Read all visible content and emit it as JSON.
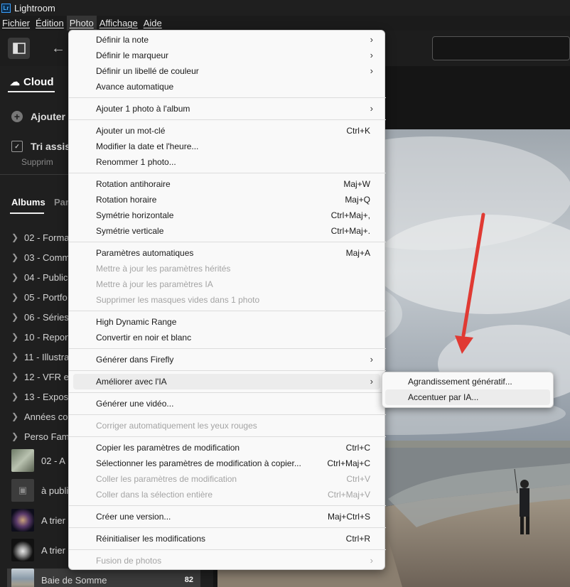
{
  "app": {
    "title": "Lightroom",
    "logo": "Lr"
  },
  "menubar": [
    "Fichier",
    "Édition",
    "Photo",
    "Affichage",
    "Aide"
  ],
  "sidebar": {
    "cloud_label": "Cloud",
    "add_label": "Ajouter",
    "sort_label": "Tri assist",
    "sub_label": "Supprim",
    "tabs": [
      "Albums",
      "Par"
    ],
    "albums": [
      "02 - Forma",
      "03 - Comm",
      "04 - Publica",
      "05 - Portfo",
      "06 - Séries",
      "10 - Report",
      "11 - Illustra",
      "12 - VFR et",
      "13 - Expos",
      "Années cor",
      "Perso Fami"
    ],
    "thumb_items": [
      "02 - A",
      "à publi",
      "A trier",
      "A trier"
    ],
    "selected_album": {
      "label": "Baie de Somme",
      "count": "82"
    }
  },
  "photo_menu": {
    "items": [
      {
        "label": "Définir la note",
        "shortcut": "",
        "submenu": true,
        "disabled": false
      },
      {
        "label": "Définir le marqueur",
        "shortcut": "",
        "submenu": true,
        "disabled": false
      },
      {
        "label": "Définir un libellé de couleur",
        "shortcut": "",
        "submenu": true,
        "disabled": false
      },
      {
        "label": "Avance automatique",
        "shortcut": "",
        "submenu": false,
        "disabled": false
      },
      {
        "label": "Ajouter 1 photo à l'album",
        "shortcut": "",
        "submenu": true,
        "disabled": false
      },
      {
        "label": "Ajouter un mot-clé",
        "shortcut": "Ctrl+K",
        "submenu": false,
        "disabled": false
      },
      {
        "label": "Modifier la date et l'heure...",
        "shortcut": "",
        "submenu": false,
        "disabled": false
      },
      {
        "label": "Renommer 1 photo...",
        "shortcut": "",
        "submenu": false,
        "disabled": false
      },
      {
        "label": "Rotation antihoraire",
        "shortcut": "Maj+W",
        "submenu": false,
        "disabled": false
      },
      {
        "label": "Rotation horaire",
        "shortcut": "Maj+Q",
        "submenu": false,
        "disabled": false
      },
      {
        "label": "Symétrie horizontale",
        "shortcut": "Ctrl+Maj+,",
        "submenu": false,
        "disabled": false
      },
      {
        "label": "Symétrie verticale",
        "shortcut": "Ctrl+Maj+.",
        "submenu": false,
        "disabled": false
      },
      {
        "label": "Paramètres automatiques",
        "shortcut": "Maj+A",
        "submenu": false,
        "disabled": false
      },
      {
        "label": "Mettre à jour les paramètres hérités",
        "shortcut": "",
        "submenu": false,
        "disabled": true
      },
      {
        "label": "Mettre à jour les paramètres IA",
        "shortcut": "",
        "submenu": false,
        "disabled": true
      },
      {
        "label": "Supprimer les masques vides dans 1 photo",
        "shortcut": "",
        "submenu": false,
        "disabled": true
      },
      {
        "label": "High Dynamic Range",
        "shortcut": "",
        "submenu": false,
        "disabled": false
      },
      {
        "label": "Convertir en noir et blanc",
        "shortcut": "",
        "submenu": false,
        "disabled": false
      },
      {
        "label": "Générer dans Firefly",
        "shortcut": "",
        "submenu": true,
        "disabled": false
      },
      {
        "label": "Améliorer avec l'IA",
        "shortcut": "",
        "submenu": true,
        "disabled": false,
        "hover": true
      },
      {
        "label": "Générer une vidéo...",
        "shortcut": "",
        "submenu": false,
        "disabled": false
      },
      {
        "label": "Corriger automatiquement les yeux rouges",
        "shortcut": "",
        "submenu": false,
        "disabled": true
      },
      {
        "label": "Copier les paramètres de modification",
        "shortcut": "Ctrl+C",
        "submenu": false,
        "disabled": false
      },
      {
        "label": "Sélectionner les paramètres de modification à copier...",
        "shortcut": "Ctrl+Maj+C",
        "submenu": false,
        "disabled": false
      },
      {
        "label": "Coller les paramètres de modification",
        "shortcut": "Ctrl+V",
        "submenu": false,
        "disabled": true
      },
      {
        "label": "Coller dans la sélection entière",
        "shortcut": "Ctrl+Maj+V",
        "submenu": false,
        "disabled": true
      },
      {
        "label": "Créer une version...",
        "shortcut": "Maj+Ctrl+S",
        "submenu": false,
        "disabled": false
      },
      {
        "label": "Réinitialiser les modifications",
        "shortcut": "Ctrl+R",
        "submenu": false,
        "disabled": false
      },
      {
        "label": "Fusion de photos",
        "shortcut": "",
        "submenu": true,
        "disabled": true
      }
    ]
  },
  "ai_submenu": {
    "items": [
      {
        "label": "Agrandissement génératif...",
        "hover": false
      },
      {
        "label": "Accentuer par IA...",
        "hover": true
      }
    ]
  },
  "colors": {
    "accent_arrow": "#e03a33",
    "menu_bg": "#f9f9f9",
    "app_bg": "#1b1b1b"
  }
}
